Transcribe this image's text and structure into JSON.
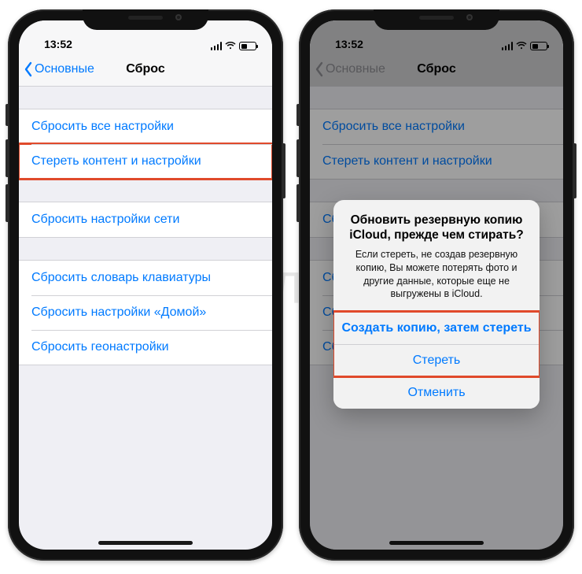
{
  "status": {
    "time": "13:52"
  },
  "nav": {
    "back": "Основные",
    "title": "Сброс"
  },
  "rows": {
    "reset_all": "Сбросить все настройки",
    "erase_all": "Стереть контент и настройки",
    "reset_network": "Сбросить настройки сети",
    "reset_keyboard": "Сбросить словарь клавиатуры",
    "reset_home": "Сбросить настройки «Домой»",
    "reset_location": "Сбросить геонастройки"
  },
  "alert": {
    "title": "Обновить резервную копию iCloud, прежде чем стирать?",
    "message": "Если стереть, не создав резервную копию, Вы можете потерять фото и другие данные, которые еще не выгружены в iCloud.",
    "backup_then_erase": "Создать копию, затем стереть",
    "erase": "Стереть",
    "cancel": "Отменить"
  },
  "watermark": "ЯБЛЫК"
}
